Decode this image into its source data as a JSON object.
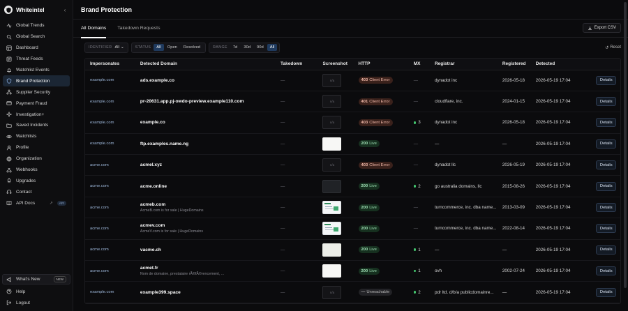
{
  "brand": {
    "name": "Whiteintel"
  },
  "sidebar": {
    "items": [
      {
        "label": "Global Trends",
        "icon": "activity-icon"
      },
      {
        "label": "Global Search",
        "icon": "search-icon"
      },
      {
        "label": "Dashboard",
        "icon": "dashboard-icon"
      },
      {
        "label": "Threat Feeds",
        "icon": "feed-icon"
      },
      {
        "label": "Watchlist Events",
        "icon": "bell-icon"
      },
      {
        "label": "Brand Protection",
        "icon": "shield-icon",
        "active": true
      },
      {
        "label": "Supplier Security",
        "icon": "network-icon"
      },
      {
        "label": "Payment Fraud",
        "icon": "card-icon"
      },
      {
        "label": "Investigation+",
        "icon": "sparkle-icon"
      },
      {
        "label": "Saved Incidents",
        "icon": "folder-icon"
      },
      {
        "label": "Watchlists",
        "icon": "eye-icon"
      },
      {
        "label": "Profile",
        "icon": "user-icon"
      },
      {
        "label": "Organization",
        "icon": "org-icon"
      },
      {
        "label": "Webhooks",
        "icon": "webhook-icon"
      },
      {
        "label": "Upgrades",
        "icon": "rocket-icon"
      },
      {
        "label": "Contact",
        "icon": "headset-icon"
      },
      {
        "label": "API Docs",
        "icon": "book-icon",
        "badge": "API"
      }
    ],
    "whats_new": {
      "label": "What's New",
      "badge": "NEW"
    },
    "help": "Help",
    "logout": "Logout"
  },
  "header": {
    "title": "Brand Protection"
  },
  "tabs": [
    {
      "label": "All Domains",
      "active": true
    },
    {
      "label": "Takedown Requests",
      "active": false
    }
  ],
  "export_label": "Export CSV",
  "filters": {
    "identifier_label": "IDENTIFIER",
    "identifier_value": "All",
    "status_label": "STATUS",
    "status_options": [
      "All",
      "Open",
      "Resolved"
    ],
    "status_selected": "All",
    "range_label": "RANGE",
    "range_options": [
      "7d",
      "30d",
      "90d",
      "All"
    ],
    "range_selected": "All",
    "reset_label": "Reset"
  },
  "table": {
    "columns": [
      "Impersonates",
      "Detected Domain",
      "Takedown",
      "Screenshot",
      "HTTP",
      "MX",
      "Registrar",
      "Registered",
      "Detected",
      ""
    ],
    "details_label": "Details",
    "rows": [
      {
        "imp": "example.com",
        "domain": "ads.example.co",
        "sub": "",
        "takedown": "—",
        "shot": "na",
        "shot_text": "n/a",
        "http_code": "403",
        "http_text": "Client Error",
        "http_kind": "err",
        "mx": "—",
        "mx_dot": false,
        "registrar": "dynadot inc",
        "registered": "2026-05-18",
        "detected": "2026-05-19 17:04"
      },
      {
        "imp": "example.com",
        "domain": "pr-20631.app.pj-owdo-preview.example110.com",
        "sub": "",
        "takedown": "—",
        "shot": "na",
        "shot_text": "n/a",
        "http_code": "401",
        "http_text": "Client Error",
        "http_kind": "err",
        "mx": "—",
        "mx_dot": false,
        "registrar": "cloudflare, inc.",
        "registered": "2024-01-15",
        "detected": "2026-05-19 17:04"
      },
      {
        "imp": "example.com",
        "domain": "example.co",
        "sub": "",
        "takedown": "—",
        "shot": "na",
        "shot_text": "n/a",
        "http_code": "403",
        "http_text": "Client Error",
        "http_kind": "err",
        "mx": "3",
        "mx_dot": true,
        "registrar": "dynadot inc",
        "registered": "2026-05-18",
        "detected": "2026-05-19 17:04"
      },
      {
        "imp": "example.com",
        "domain": "ftp.examples.name.ng",
        "sub": "",
        "takedown": "—",
        "shot": "white",
        "shot_text": "",
        "http_code": "200",
        "http_text": "Live",
        "http_kind": "ok",
        "mx": "—",
        "mx_dot": false,
        "registrar": "—",
        "registered": "—",
        "detected": "2026-05-19 17:04"
      },
      {
        "imp": "acme.com",
        "domain": "acmel.xyz",
        "sub": "",
        "takedown": "—",
        "shot": "na",
        "shot_text": "n/a",
        "http_code": "403",
        "http_text": "Client Error",
        "http_kind": "err",
        "mx": "—",
        "mx_dot": false,
        "registrar": "dynadot llc",
        "registered": "2026-05-19",
        "detected": "2026-05-19 17:04"
      },
      {
        "imp": "acme.com",
        "domain": "acme.online",
        "sub": "",
        "takedown": "—",
        "shot": "dark",
        "shot_text": "",
        "http_code": "200",
        "http_text": "Live",
        "http_kind": "ok",
        "mx": "2",
        "mx_dot": true,
        "registrar": "go australia domains, llc",
        "registered": "2015-08-26",
        "detected": "2026-05-19 17:04"
      },
      {
        "imp": "acme.com",
        "domain": "acmeb.com",
        "sub": "AcmeB.com is for sale | HugeDomains",
        "takedown": "—",
        "shot": "page",
        "shot_text": "",
        "http_code": "200",
        "http_text": "Live",
        "http_kind": "ok",
        "mx": "—",
        "mx_dot": false,
        "registrar": "turncommerce, inc. dba name...",
        "registered": "2013-03-09",
        "detected": "2026-05-19 17:04"
      },
      {
        "imp": "acme.com",
        "domain": "acmev.com",
        "sub": "AcmeV.com is for sale | HugeDomains",
        "takedown": "—",
        "shot": "page",
        "shot_text": "",
        "http_code": "200",
        "http_text": "Live",
        "http_kind": "ok",
        "mx": "—",
        "mx_dot": false,
        "registrar": "turncommerce, inc. dba name...",
        "registered": "2022-08-14",
        "detected": "2026-05-19 17:04"
      },
      {
        "imp": "acme.com",
        "domain": "vacme.ch",
        "sub": "",
        "takedown": "—",
        "shot": "cream",
        "shot_text": "",
        "http_code": "200",
        "http_text": "Live",
        "http_kind": "ok",
        "mx": "1",
        "mx_dot": true,
        "registrar": "—",
        "registered": "—",
        "detected": "2026-05-19 17:04"
      },
      {
        "imp": "acme.com",
        "domain": "acmet.fr",
        "sub": "Nom de domaine, prestataire rÃ©fÃ©rencement, ...",
        "takedown": "—",
        "shot": "white",
        "shot_text": "",
        "http_code": "200",
        "http_text": "Live",
        "http_kind": "ok",
        "mx": "1",
        "mx_dot": true,
        "registrar": "ovh",
        "registered": "2002-07-24",
        "detected": "2026-05-19 17:04"
      },
      {
        "imp": "example.com",
        "domain": "example399.space",
        "sub": "",
        "takedown": "—",
        "shot": "na",
        "shot_text": "n/a",
        "http_code": "—",
        "http_text": "Unreachable",
        "http_kind": "unr",
        "mx": "2",
        "mx_dot": true,
        "registrar": "pdr ltd. d/b/a publicdomainre...",
        "registered": "—",
        "detected": "2026-05-19 17:04"
      }
    ]
  }
}
